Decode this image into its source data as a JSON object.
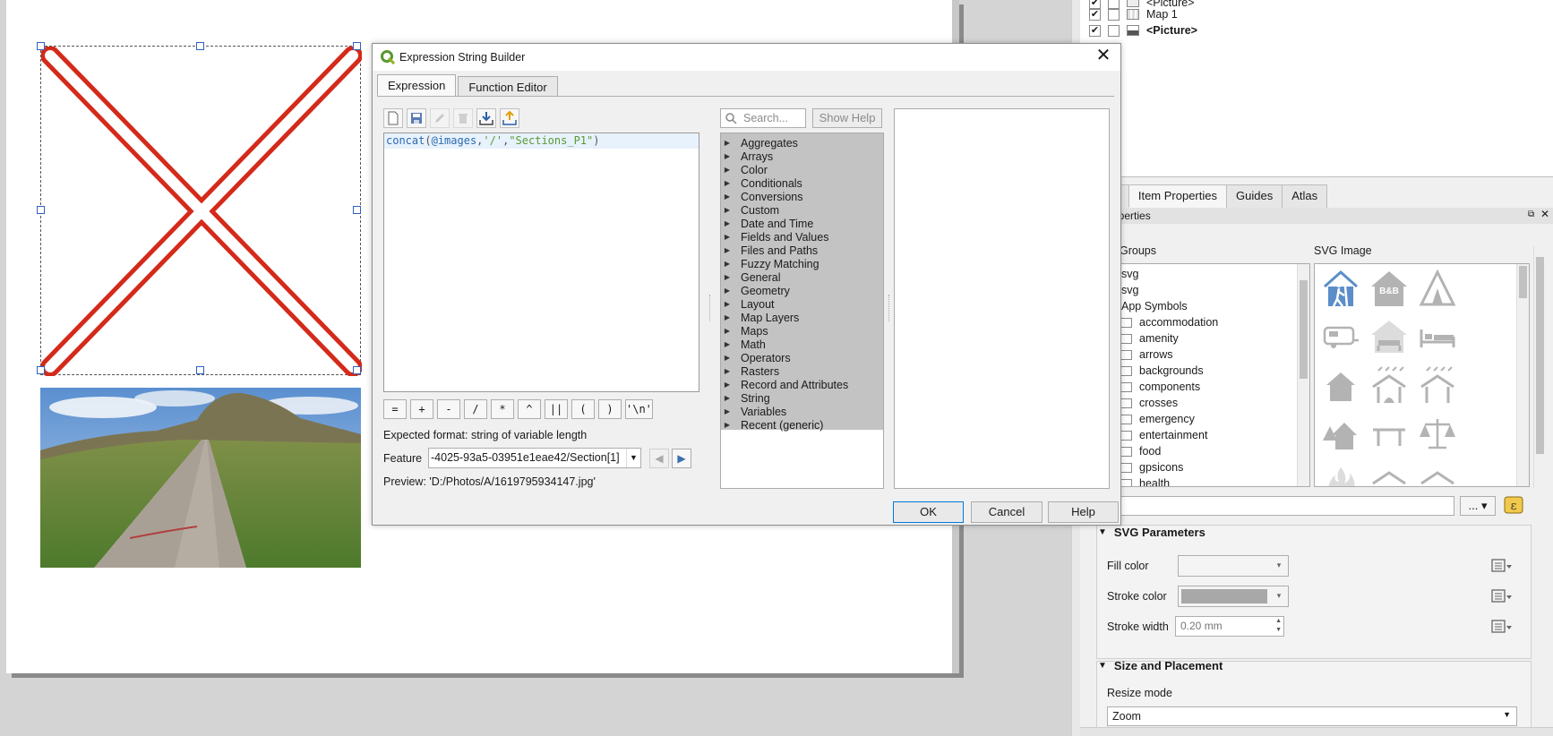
{
  "items_panel": {
    "rows": [
      {
        "checked": true,
        "label": "<Picture>",
        "bold": false,
        "partial": true
      },
      {
        "checked": true,
        "label": "Map 1",
        "bold": false
      },
      {
        "checked": true,
        "label": "<Picture>",
        "bold": true
      }
    ]
  },
  "dock_tabs": [
    "ut",
    "Item Properties",
    "Guides",
    "Atlas"
  ],
  "properties": {
    "panel_title": "operties",
    "section_title": "e",
    "groups_header": "Groups",
    "svg_image_header": "SVG Image",
    "groups": [
      "svg",
      "svg",
      "App Symbols",
      "accommodation",
      "amenity",
      "arrows",
      "backgrounds",
      "components",
      "crosses",
      "emergency",
      "entertainment",
      "food",
      "gpsicons",
      "health"
    ],
    "svg_params_title": "SVG Parameters",
    "fill_color_label": "Fill color",
    "stroke_color_label": "Stroke color",
    "stroke_width_label": "Stroke width",
    "stroke_width_value": "0.20 mm",
    "size_placement_title": "Size and Placement",
    "resize_mode_label": "Resize mode",
    "resize_mode_value": "Zoom",
    "browse_button": "..."
  },
  "dialog": {
    "title": "Expression String Builder",
    "tabs": [
      "Expression",
      "Function Editor"
    ],
    "expression": {
      "fn": "concat",
      "open": "(",
      "var": "@images",
      "sep1": ",",
      "str": "'/'",
      "sep2": ",",
      "field": "\"Sections_P1\"",
      "close": ")"
    },
    "operators": [
      "=",
      "+",
      "-",
      "/",
      "*",
      "^",
      "||",
      "(",
      ")",
      "'\\n'"
    ],
    "expected_format": "Expected format: string of variable length",
    "feature_label": "Feature",
    "feature_value": "-4025-93a5-03951e1eae42/Section[1]",
    "preview": "Preview: 'D:/Photos/A/1619795934147.jpg'",
    "search_placeholder": "Search...",
    "show_help": "Show Help",
    "function_groups": [
      "Aggregates",
      "Arrays",
      "Color",
      "Conditionals",
      "Conversions",
      "Custom",
      "Date and Time",
      "Fields and Values",
      "Files and Paths",
      "Fuzzy Matching",
      "General",
      "Geometry",
      "Layout",
      "Map Layers",
      "Maps",
      "Math",
      "Operators",
      "Rasters",
      "Record and Attributes",
      "String",
      "Variables",
      "Recent (generic)"
    ],
    "ok": "OK",
    "cancel": "Cancel",
    "help": "Help"
  },
  "colors": {
    "cross_red": "#d42a1a",
    "accent_blue": "#0078d7",
    "svg_icon_blue": "#5b8ec9",
    "svg_icon_gray": "#b3b3b3",
    "selection_gray": "#c3c3c3"
  }
}
